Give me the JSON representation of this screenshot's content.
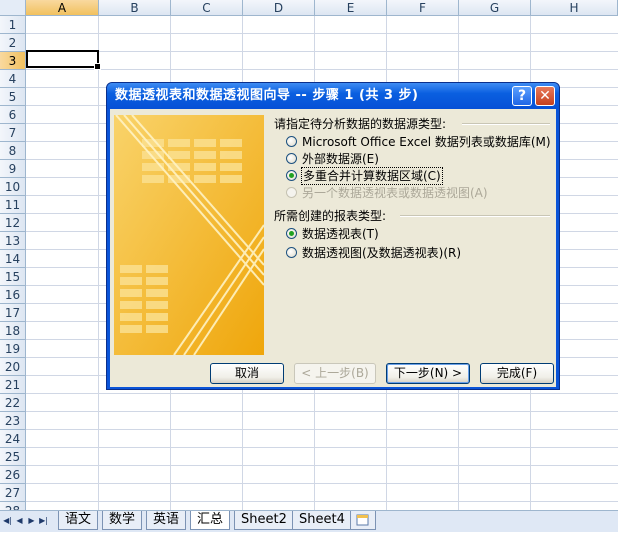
{
  "sheet": {
    "columns": [
      "A",
      "B",
      "C",
      "D",
      "E",
      "F",
      "G",
      "H"
    ],
    "rows": [
      "1",
      "2",
      "3",
      "4",
      "5",
      "6",
      "7",
      "8",
      "9",
      "10",
      "11",
      "12",
      "13",
      "14",
      "15",
      "16",
      "17",
      "18",
      "19",
      "20",
      "21",
      "22",
      "23",
      "24",
      "25",
      "26",
      "27",
      "28"
    ],
    "selected_column": "A",
    "selected_row": "3"
  },
  "tabs": {
    "items": [
      "语文",
      "数学",
      "英语",
      "汇总",
      "Sheet2",
      "Sheet4"
    ],
    "active": "汇总"
  },
  "dialog": {
    "title": "数据透视表和数据透视图向导 -- 步骤 1 (共 3 步)",
    "help_label": "?",
    "close_label": "✕",
    "source_group": "请指定待分析数据的数据源类型:",
    "source_options": [
      {
        "label": "Microsoft Office Excel 数据列表或数据库(M)",
        "checked": false,
        "disabled": false
      },
      {
        "label": "外部数据源(E)",
        "checked": false,
        "disabled": false
      },
      {
        "label": "多重合并计算数据区域(C)",
        "checked": true,
        "disabled": false
      },
      {
        "label": "另一个数据透视表或数据透视图(A)",
        "checked": false,
        "disabled": true
      }
    ],
    "report_group": "所需创建的报表类型:",
    "report_options": [
      {
        "label": "数据透视表(T)",
        "checked": true
      },
      {
        "label": "数据透视图(及数据透视表)(R)",
        "checked": false
      }
    ],
    "buttons": {
      "cancel": "取消",
      "back": "< 上一步(B)",
      "next": "下一步(N) >",
      "finish": "完成(F)"
    }
  },
  "colors": {
    "title_bar": "#0a5fe0",
    "dialog_face": "#ece9d8",
    "wizard_art": "#f3b519"
  }
}
